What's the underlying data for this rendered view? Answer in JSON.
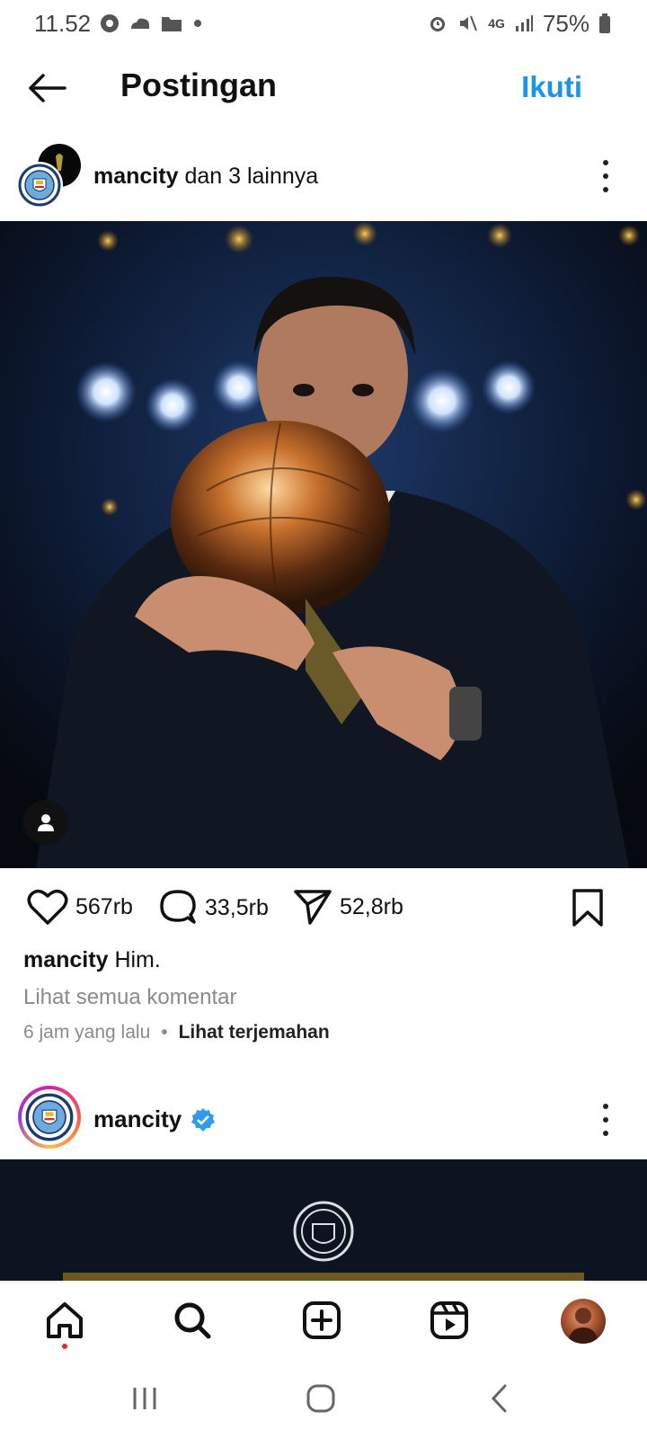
{
  "status_bar": {
    "time": "11.52",
    "network": "4G",
    "battery": "75%",
    "left_icons": [
      "chrome-icon",
      "cloud-icon",
      "folder-icon",
      "dot-icon"
    ],
    "right_icons": [
      "alarm-icon",
      "mute-icon",
      "network-4g-icon",
      "signal-icon",
      "battery-icon"
    ]
  },
  "header": {
    "title": "Postingan",
    "follow_label": "Ikuti",
    "accent_color": "#1a95e8"
  },
  "post": {
    "author": "mancity",
    "coauthors_text": "dan 3 lainnya",
    "likes": "567rb",
    "comments": "33,5rb",
    "shares": "52,8rb",
    "caption_user": "mancity",
    "caption_text": "Him.",
    "view_comments": "Lihat semua komentar",
    "time_ago": "6 jam yang lalu",
    "translate_label": "Lihat terjemahan"
  },
  "post2": {
    "author": "mancity",
    "verified": true
  },
  "bottom_nav": {
    "items": [
      "home-icon",
      "search-icon",
      "create-icon",
      "reels-icon",
      "profile-avatar"
    ],
    "notification_color": "#e8263e"
  },
  "system_nav": {
    "items": [
      "recent-apps-icon",
      "home-circle-icon",
      "back-chevron-icon"
    ]
  }
}
